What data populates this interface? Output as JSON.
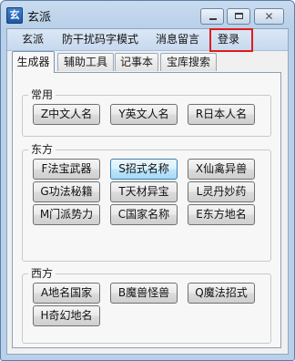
{
  "window": {
    "title": "玄派",
    "icon_glyph": "玄",
    "close_glyph": "✕"
  },
  "menu": [
    "玄派",
    "防干扰码字模式",
    "消息留言",
    "登录"
  ],
  "highlighted_menu_item": "登录",
  "highlight_color": "#e01b1b",
  "tabs": [
    "生成器",
    "辅助工具",
    "记事本",
    "宝库搜索"
  ],
  "active_tab": "生成器",
  "groups": [
    {
      "title": "常用",
      "buttons": [
        "Z中文人名",
        "Y英文人名",
        "R日本人名"
      ]
    },
    {
      "title": "东方",
      "buttons": [
        "F法宝武器",
        "S招式名称",
        "X仙禽异兽",
        "G功法秘籍",
        "T天材异宝",
        "L灵丹妙药",
        "M门派势力",
        "C国家名称",
        "E东方地名"
      ]
    },
    {
      "title": "西方",
      "buttons": [
        "A地名国家",
        "B魔兽怪兽",
        "Q魔法招式",
        "H奇幻地名"
      ]
    }
  ],
  "focused_button": "S招式名称"
}
